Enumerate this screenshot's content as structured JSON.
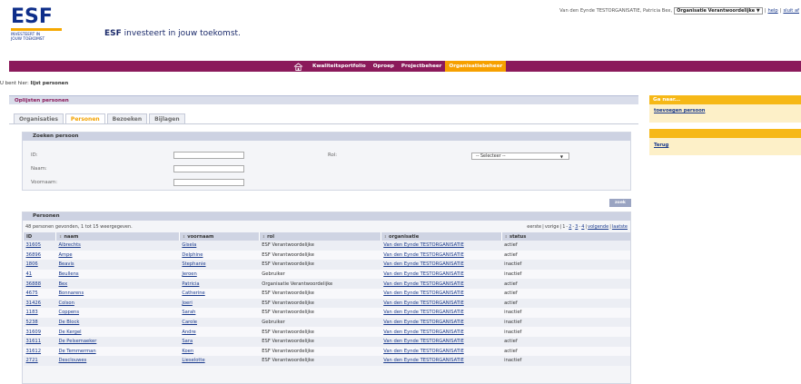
{
  "header": {
    "user_text": "Van den Eynde TESTORGANISATIE,  Patricia Bex,",
    "org_select_value": "Organisatie Verantwoordelijke",
    "help_label": "help",
    "logout_label": "sluit af",
    "separator": "|",
    "logo_mark": "ESF",
    "logo_sub_line1": "INVESTEERT IN",
    "logo_sub_line2": "JOUW TOEKOMST",
    "tagline_bold": "ESF",
    "tagline_rest": " investeert in jouw toekomst."
  },
  "nav": {
    "items": [
      "Kwaliteitsportfolio",
      "Oproep",
      "Projectbeheer",
      "Organisatiebeheer"
    ],
    "active_index": 3
  },
  "breadcrumb": {
    "prefix": "U bent hier: ",
    "current": "lijst personen"
  },
  "panel": {
    "title": "Oplijsten personen",
    "tabs": [
      "Organisaties",
      "Personen",
      "Bezoeken",
      "Bijlagen"
    ],
    "active_tab": 1
  },
  "search": {
    "title": "Zoeken persoon",
    "id_label": "ID:",
    "naam_label": "Naam:",
    "voornaam_label": "Voornaam:",
    "rol_label": "Rol:",
    "rol_value": "-- Selecteer --",
    "button_label": "zoek"
  },
  "persons": {
    "title": "Personen",
    "result_info": "48 personen gevonden, 1 tot 15 weergegeven.",
    "pager": {
      "first": "eerste",
      "previous": "vorige",
      "pages": [
        "1",
        "2",
        "3",
        "4"
      ],
      "next": "volgende",
      "last": "laatste"
    },
    "columns": [
      "ID",
      "naam",
      "voornaam",
      "rol",
      "organisatie",
      "status"
    ],
    "rows": [
      [
        "31605",
        "Albrechts",
        "Gisela",
        "ESF Verantwoordelijke",
        "Van den Eynde TESTORGANISATIE",
        "actief"
      ],
      [
        "36896",
        "Ampe",
        "Delphine",
        "ESF Verantwoordelijke",
        "Van den Eynde TESTORGANISATIE",
        "actief"
      ],
      [
        "1806",
        "Beavis",
        "Stephanie",
        "ESF Verantwoordelijke",
        "Van den Eynde TESTORGANISATIE",
        "inactief"
      ],
      [
        "41",
        "Beullens",
        "Jeroen",
        "Gebruiker",
        "Van den Eynde TESTORGANISATIE",
        "inactief"
      ],
      [
        "36888",
        "Bex",
        "Patricia",
        "Organisatie Verantwoordelijke",
        "Van den Eynde TESTORGANISATIE",
        "actief"
      ],
      [
        "4675",
        "Bonnarens",
        "Catherine",
        "ESF Verantwoordelijke",
        "Van den Eynde TESTORGANISATIE",
        "actief"
      ],
      [
        "31426",
        "Colson",
        "Joeri",
        "ESF Verantwoordelijke",
        "Van den Eynde TESTORGANISATIE",
        "actief"
      ],
      [
        "1183",
        "Coppens",
        "Sarah",
        "ESF Verantwoordelijke",
        "Van den Eynde TESTORGANISATIE",
        "inactief"
      ],
      [
        "5238",
        "De Block",
        "Carole",
        "Gebruiker",
        "Van den Eynde TESTORGANISATIE",
        "inactief"
      ],
      [
        "31609",
        "De Kergel",
        "Andre",
        "ESF Verantwoordelijke",
        "Van den Eynde TESTORGANISATIE",
        "inactief"
      ],
      [
        "31611",
        "De Pelsemaeker",
        "Sara",
        "ESF Verantwoordelijke",
        "Van den Eynde TESTORGANISATIE",
        "actief"
      ],
      [
        "31612",
        "De Temmerman",
        "Koen",
        "ESF Verantwoordelijke",
        "Van den Eynde TESTORGANISATIE",
        "actief"
      ],
      [
        "2721",
        "Desclouwes",
        "Lieselotte",
        "ESF Verantwoordelijke",
        "Van den Eynde TESTORGANISATIE",
        "inactief"
      ]
    ]
  },
  "sidebar": {
    "goto_title": "Ga naar...",
    "goto_link": "toevoegen persoon",
    "back_link": "Terug"
  },
  "colors": {
    "nav_bg": "#8b1a5b",
    "accent": "#f6a000",
    "link": "#1a3a8c",
    "logo_blue": "#0e2e8a"
  }
}
